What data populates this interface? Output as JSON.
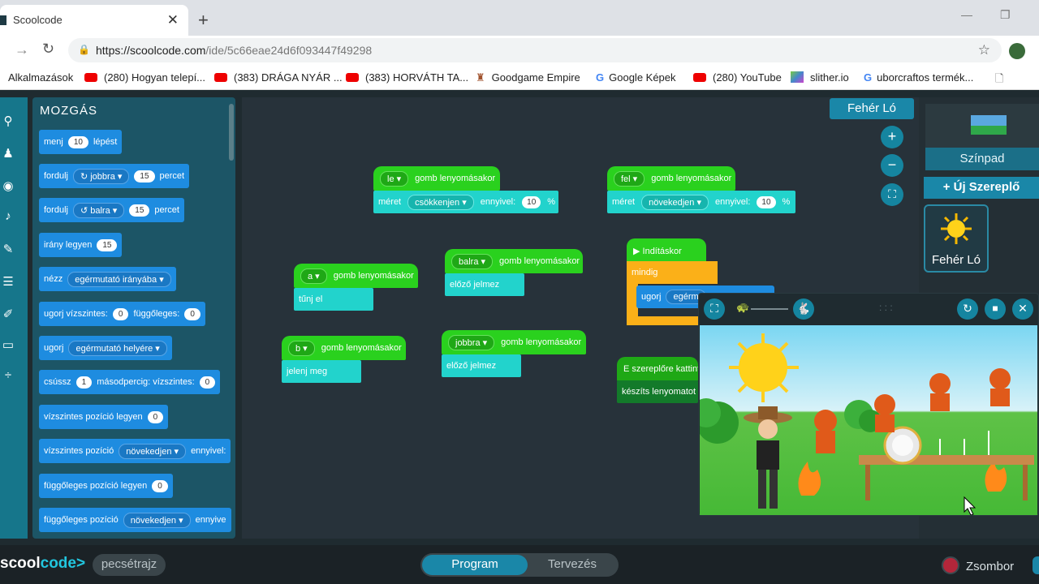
{
  "browser": {
    "tab_title": "Scoolcode",
    "close": "✕",
    "new_tab": "+",
    "url_host": "https://scoolcode.com",
    "url_path": "/ide/5c66eae24d6f093447f49298",
    "bookmarks": [
      {
        "label": "Alkalmazások",
        "icon": "apps-grid-icon"
      },
      {
        "label": "(280) Hogyan telepí...",
        "icon": "youtube-icon"
      },
      {
        "label": "(383) DRÁGA NYÁR ...",
        "icon": "youtube-icon"
      },
      {
        "label": "(383) HORVÁTH TA...",
        "icon": "youtube-icon"
      },
      {
        "label": "Goodgame Empire",
        "icon": "castle-icon"
      },
      {
        "label": "Google Képek",
        "icon": "google-icon"
      },
      {
        "label": "(280) YouTube",
        "icon": "youtube-icon"
      },
      {
        "label": "slither.io",
        "icon": "slither-icon"
      },
      {
        "label": "uborcraftos termék...",
        "icon": "google-icon"
      }
    ]
  },
  "palette": {
    "title": "MOZGÁS",
    "blocks": {
      "move": {
        "t1": "menj",
        "v1": "10",
        "t2": "lépést"
      },
      "turn_right": {
        "t1": "fordulj",
        "dd": "↻ jobbra",
        "v1": "15",
        "t2": "percet"
      },
      "turn_left": {
        "t1": "fordulj",
        "dd": "↺ balra",
        "v1": "15",
        "t2": "percet"
      },
      "direction": {
        "t1": "irány legyen",
        "v1": "15"
      },
      "point": {
        "t1": "nézz",
        "dd": "egérmutató irányába"
      },
      "goto_xy": {
        "t1": "ugorj vízszintes:",
        "v1": "0",
        "t2": "függőleges:",
        "v2": "0"
      },
      "goto": {
        "t1": "ugorj",
        "dd": "egérmutató helyére"
      },
      "glide": {
        "t1": "csússz",
        "v1": "1",
        "t2": "másodpercig: vízszintes:",
        "v2": "0"
      },
      "set_x": {
        "t1": "vízszintes pozíció legyen",
        "v1": "0"
      },
      "change_x": {
        "t1": "vízszintes pozíció",
        "dd": "növekedjen",
        "t2": "ennyivel:"
      },
      "set_y": {
        "t1": "függőleges pozíció legyen",
        "v1": "0"
      },
      "change_y": {
        "t1": "függőleges pozíció",
        "dd": "növekedjen",
        "t2": "ennyive"
      }
    }
  },
  "script": {
    "when_key_le": {
      "key": "le",
      "label": "gomb lenyomásakor"
    },
    "size_down": {
      "t1": "méret",
      "dd": "csökkenjen",
      "t2": "ennyivel:",
      "v": "10",
      "unit": "%"
    },
    "when_key_fel": {
      "key": "fel",
      "label": "gomb lenyomásakor"
    },
    "size_up": {
      "t1": "méret",
      "dd": "növekedjen",
      "t2": "ennyivel:",
      "v": "10",
      "unit": "%"
    },
    "when_key_a": {
      "key": "a",
      "label": "gomb lenyomásakor"
    },
    "hide": "tűnj el",
    "when_key_balra": {
      "key": "balra",
      "label": "gomb lenyomásakor"
    },
    "prev_costume_1": "előző jelmez",
    "when_key_b": {
      "key": "b",
      "label": "gomb lenyomásakor"
    },
    "show": "jelenj meg",
    "when_key_jobbra": {
      "key": "jobbra",
      "label": "gomb lenyomásakor"
    },
    "prev_costume_2": "előző jelmez",
    "when_start": "▶ Indításkor",
    "forever": "mindig",
    "goto_inner": {
      "t1": "ugorj",
      "dd": "egérm"
    },
    "when_clicked": "E szereplőre kattint",
    "make_sound": "készíts lenyomatot"
  },
  "sprite_label": "Fehér Ló",
  "stage_label": "Színpad",
  "new_sprite": "+ Új Szereplő",
  "sprite_card_name": "Fehér Ló",
  "zoom": {
    "in": "+",
    "out": "−",
    "fit": "⛶"
  },
  "bottom": {
    "logo_a": "scool",
    "logo_b": "code",
    "logo_c": ">",
    "project_name": "pecsétrajz",
    "mode_program": "Program",
    "mode_design": "Tervezés",
    "user": "Zsombor"
  },
  "colors": {
    "accent": "#1a87a8",
    "event": "#2ad11e",
    "motion": "#1e8ce0",
    "looks": "#22d3cc",
    "control": "#fbb018"
  }
}
